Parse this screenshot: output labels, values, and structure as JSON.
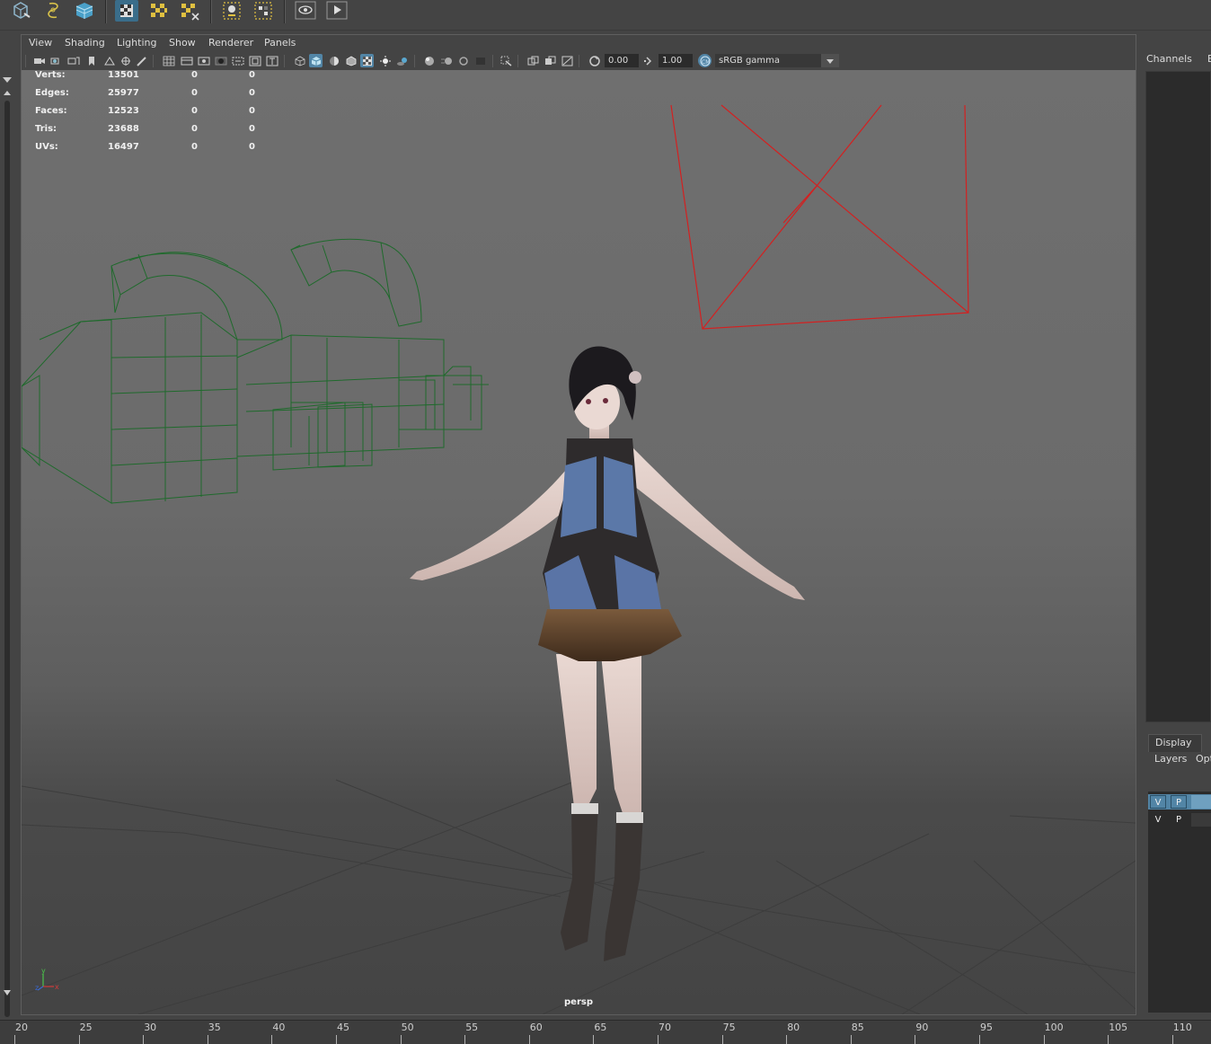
{
  "shelf": {
    "icons": [
      "create-object-icon",
      "lasso-icon",
      "cube-icon",
      "checker-select-icon",
      "checker-icon",
      "checker-delete-icon",
      "bookmark-icon",
      "grid-select-icon",
      "eye-icon",
      "play-icon"
    ]
  },
  "menubar": {
    "items": [
      "View",
      "Shading",
      "Lighting",
      "Show",
      "Renderer",
      "Panels"
    ]
  },
  "toolbar": {
    "exposure": "0.00",
    "gamma": "1.00",
    "color_space": "sRGB gamma"
  },
  "hud": {
    "rows": [
      {
        "label": "Verts:",
        "value": "13501",
        "c2": "0",
        "c3": "0"
      },
      {
        "label": "Edges:",
        "value": "25977",
        "c2": "0",
        "c3": "0"
      },
      {
        "label": "Faces:",
        "value": "12523",
        "c2": "0",
        "c3": "0"
      },
      {
        "label": "Tris:",
        "value": "23688",
        "c2": "0",
        "c3": "0"
      },
      {
        "label": "UVs:",
        "value": "16497",
        "c2": "0",
        "c3": "0"
      }
    ]
  },
  "viewport": {
    "camera": "persp",
    "axis": {
      "x": "x",
      "y": "y",
      "z": "z"
    }
  },
  "right_panel": {
    "channels_tab": "Channels",
    "channels_tab_2": "E",
    "display_tab": "Display",
    "layers_menu": "Layers",
    "options_menu": "Opt",
    "layer_rows": [
      {
        "v": "V",
        "p": "P"
      },
      {
        "v": "V",
        "p": "P"
      }
    ]
  },
  "timeslider": {
    "ticks": [
      "20",
      "25",
      "30",
      "35",
      "40",
      "45",
      "50",
      "55",
      "60",
      "65",
      "70",
      "75",
      "80",
      "85",
      "90",
      "95",
      "100",
      "105",
      "110"
    ]
  },
  "colors": {
    "accent": "#5285a6",
    "wire_green": "#1e6b2a",
    "wire_red": "#d42020"
  }
}
